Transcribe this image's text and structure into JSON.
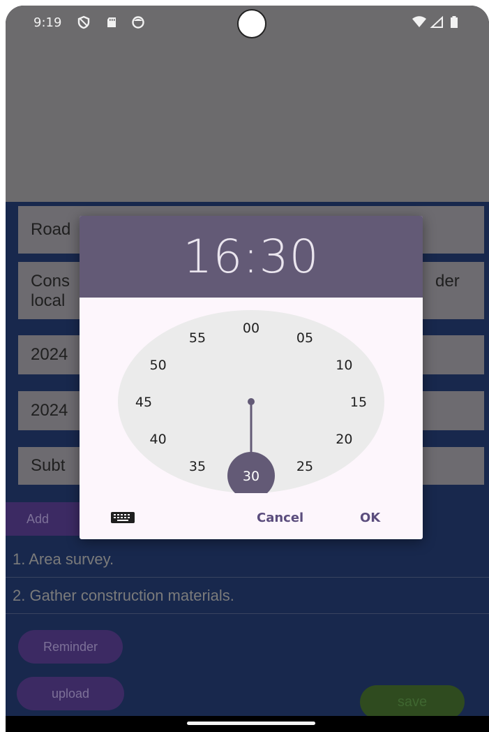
{
  "status_bar": {
    "time": "9:19",
    "left_icons": [
      "shield-icon",
      "sd-card-icon",
      "face-icon"
    ],
    "right_icons": [
      "wifi-icon",
      "cell-signal-icon",
      "battery-icon"
    ]
  },
  "form": {
    "title_value": "Road",
    "description_value_line1": "Cons",
    "description_value_line2": "local",
    "description_value_tail": "der",
    "start_date_value": "2024",
    "end_date_value": "2024",
    "subtask_placeholder": "Subt",
    "add_button": "Add",
    "reminder_button": "Reminder",
    "upload_button": "upload",
    "save_button": "save"
  },
  "subtasks": [
    {
      "text": "1. Area survey."
    },
    {
      "text": "2. Gather construction materials."
    }
  ],
  "time_picker": {
    "hour": "16",
    "separator": ":",
    "minute": "30",
    "selected_minute": 30,
    "minute_labels": [
      "00",
      "05",
      "10",
      "15",
      "20",
      "25",
      "30",
      "35",
      "40",
      "45",
      "50",
      "55"
    ],
    "cancel_label": "Cancel",
    "ok_label": "OK",
    "input_mode_icon": "keyboard-icon"
  },
  "colors": {
    "header_bg": "#635a76",
    "accent": "#635a76",
    "clock_bg": "#ebebeb",
    "dialog_bg": "#fdf6fc",
    "app_bg_dimmed": "#18284d"
  }
}
